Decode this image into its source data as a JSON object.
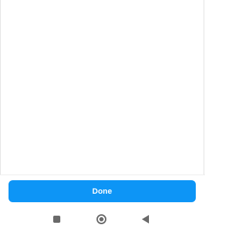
{
  "footer": {
    "done_label": "Done"
  },
  "nav_bar": {
    "recents_icon": "square-icon",
    "home_icon": "circle-icon",
    "back_icon": "triangle-back-icon"
  },
  "colors": {
    "primary_button": "#0d95f6",
    "nav_icon": "#6a6a6a",
    "background": "#ffffff"
  }
}
